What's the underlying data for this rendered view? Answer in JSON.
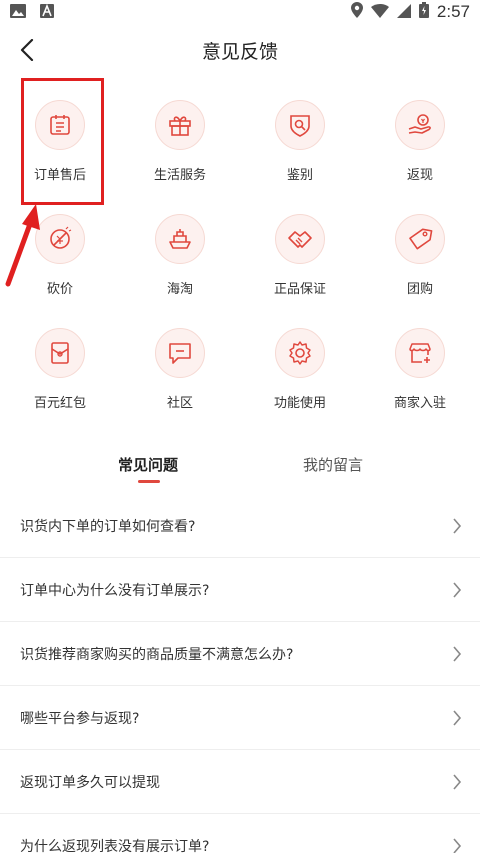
{
  "status_bar": {
    "time": "2:57"
  },
  "header": {
    "title": "意见反馈"
  },
  "grid": [
    {
      "label": "订单售后",
      "icon": "order-icon"
    },
    {
      "label": "生活服务",
      "icon": "gift-icon"
    },
    {
      "label": "鉴别",
      "icon": "search-shield-icon"
    },
    {
      "label": "返现",
      "icon": "cashback-hand-icon"
    },
    {
      "label": "砍价",
      "icon": "no-price-icon"
    },
    {
      "label": "海淘",
      "icon": "ship-icon"
    },
    {
      "label": "正品保证",
      "icon": "handshake-icon"
    },
    {
      "label": "团购",
      "icon": "tag-icon"
    },
    {
      "label": "百元红包",
      "icon": "red-envelope-icon"
    },
    {
      "label": "社区",
      "icon": "chat-icon"
    },
    {
      "label": "功能使用",
      "icon": "gear-icon"
    },
    {
      "label": "商家入驻",
      "icon": "store-icon"
    }
  ],
  "tabs": {
    "faq": "常见问题",
    "my_messages": "我的留言"
  },
  "faq": [
    "识货内下单的订单如何查看?",
    "订单中心为什么没有订单展示?",
    "识货推荐商家购买的商品质量不满意怎么办?",
    "哪些平台参与返现?",
    "返现订单多久可以提现",
    "为什么返现列表没有展示订单?"
  ],
  "colors": {
    "accent": "#e0483e",
    "icon_bg": "#fdf1ef",
    "highlight": "#e02020"
  }
}
